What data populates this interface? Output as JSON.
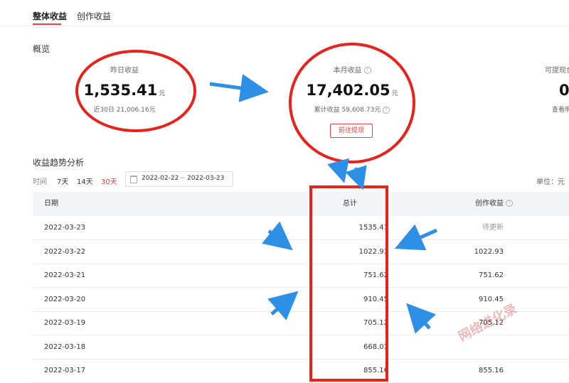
{
  "tabs": [
    {
      "label": "整体收益",
      "active": true
    },
    {
      "label": "创作收益",
      "active": false
    }
  ],
  "overview": {
    "title": "概览",
    "yesterday": {
      "label": "昨日收益",
      "value": "1,535.41",
      "unit": "元",
      "sub": "近30日 21,006.16元"
    },
    "month": {
      "label": "本月收益",
      "value": "17,402.05",
      "unit": "元",
      "sub": "累计收益 59,608.73元",
      "withdraw_label": "前往提现"
    },
    "withdrawable": {
      "label": "可提现金",
      "value": "0",
      "sub": "查看明"
    }
  },
  "trend": {
    "title": "收益趋势分析",
    "time_label": "时间",
    "ranges": [
      {
        "label": "7天",
        "active": false
      },
      {
        "label": "14天",
        "active": false
      },
      {
        "label": "30天",
        "active": true
      }
    ],
    "date_start": "2022-02-22",
    "date_sep": "~",
    "date_end": "2022-03-23",
    "unit_label": "单位：元"
  },
  "table": {
    "headers": {
      "date": "日期",
      "total": "总计",
      "creation": "创作收益"
    },
    "rows": [
      {
        "date": "2022-03-23",
        "total": "1535.41",
        "creation": "待更新"
      },
      {
        "date": "2022-03-22",
        "total": "1022.93",
        "creation": "1022.93"
      },
      {
        "date": "2022-03-21",
        "total": "751.62",
        "creation": "751.62"
      },
      {
        "date": "2022-03-20",
        "total": "910.45",
        "creation": "910.45"
      },
      {
        "date": "2022-03-19",
        "total": "705.12",
        "creation": "705.12"
      },
      {
        "date": "2022-03-18",
        "total": "668.01",
        "creation": ""
      },
      {
        "date": "2022-03-17",
        "total": "855.16",
        "creation": "855.16"
      }
    ]
  },
  "icons": {
    "help": "question-circle-icon",
    "calendar": "calendar-icon"
  },
  "colors": {
    "accent": "#e8403c",
    "annotation_red": "#e8231b",
    "annotation_blue": "#2e8fe6"
  },
  "watermark": "网络进化录"
}
